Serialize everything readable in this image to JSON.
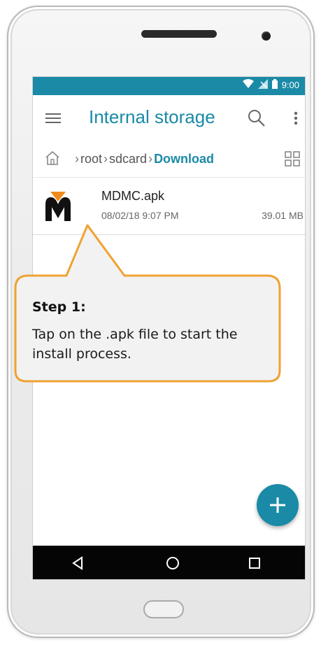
{
  "status_bar": {
    "time": "9:00"
  },
  "app_bar": {
    "title": "Internal storage"
  },
  "breadcrumb": {
    "items": [
      "root",
      "sdcard",
      "Download"
    ]
  },
  "file": {
    "name": "MDMC.apk",
    "date": "08/02/18 9:07 PM",
    "size": "39.01 MB"
  },
  "callout": {
    "title": "Step 1:",
    "body": "Tap on the .apk file to start the install process."
  },
  "colors": {
    "accent": "#1a8aa6",
    "callout_border": "#f0a232",
    "logo_orange": "#f08a1c"
  },
  "icons": [
    "menu-icon",
    "search-icon",
    "more-vert-icon",
    "home-folder-icon",
    "grid-view-icon",
    "apk-logo-icon",
    "add-icon",
    "back-icon",
    "home-circle-icon",
    "recents-icon"
  ]
}
